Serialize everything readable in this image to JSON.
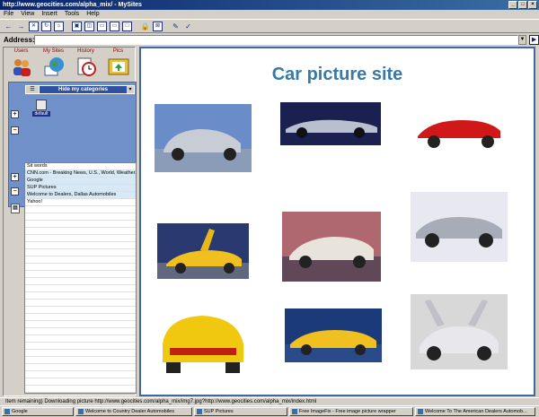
{
  "window": {
    "title": "http://www.geocities.com/alpha_mix/ - MySites"
  },
  "menu": [
    "File",
    "View",
    "Insert",
    "Tools",
    "Help"
  ],
  "address": {
    "label": "Address:",
    "value": ""
  },
  "sidebar": {
    "tabs": [
      {
        "label": "Users",
        "icon": "users-icon"
      },
      {
        "label": "My Sites",
        "icon": "globe-icon"
      },
      {
        "label": "History",
        "icon": "history-clock-icon"
      },
      {
        "label": "Pics",
        "icon": "pictures-icon"
      }
    ],
    "categories": {
      "header": "Hide my categories",
      "folder_label": "default"
    },
    "sites": [
      "Sit words",
      "CNN.com - Breaking News, U.S., World, Weather, Ent",
      "Google",
      "SUP Pictures",
      "Welcome to Dealers, Dallas Automobiles",
      "Yahoo!"
    ]
  },
  "content": {
    "title": "Car picture site"
  },
  "status": "Item remaining) Downloading picture http://www.geocities.com/alpha_mix/img7.jpg?http://www.geocities.com/alpha_mix/index.html",
  "taskbar": [
    "Google",
    "Welcome to Country Dealer Automobiles",
    "SUP Pictures",
    "Free ImageFix - Free image picture wrapper",
    "Welcome To The American Dealers Automob..."
  ],
  "colors": {
    "title_accent": "#3a78a8",
    "content_border": "#4068a8",
    "category_panel": "#6f90c8"
  }
}
